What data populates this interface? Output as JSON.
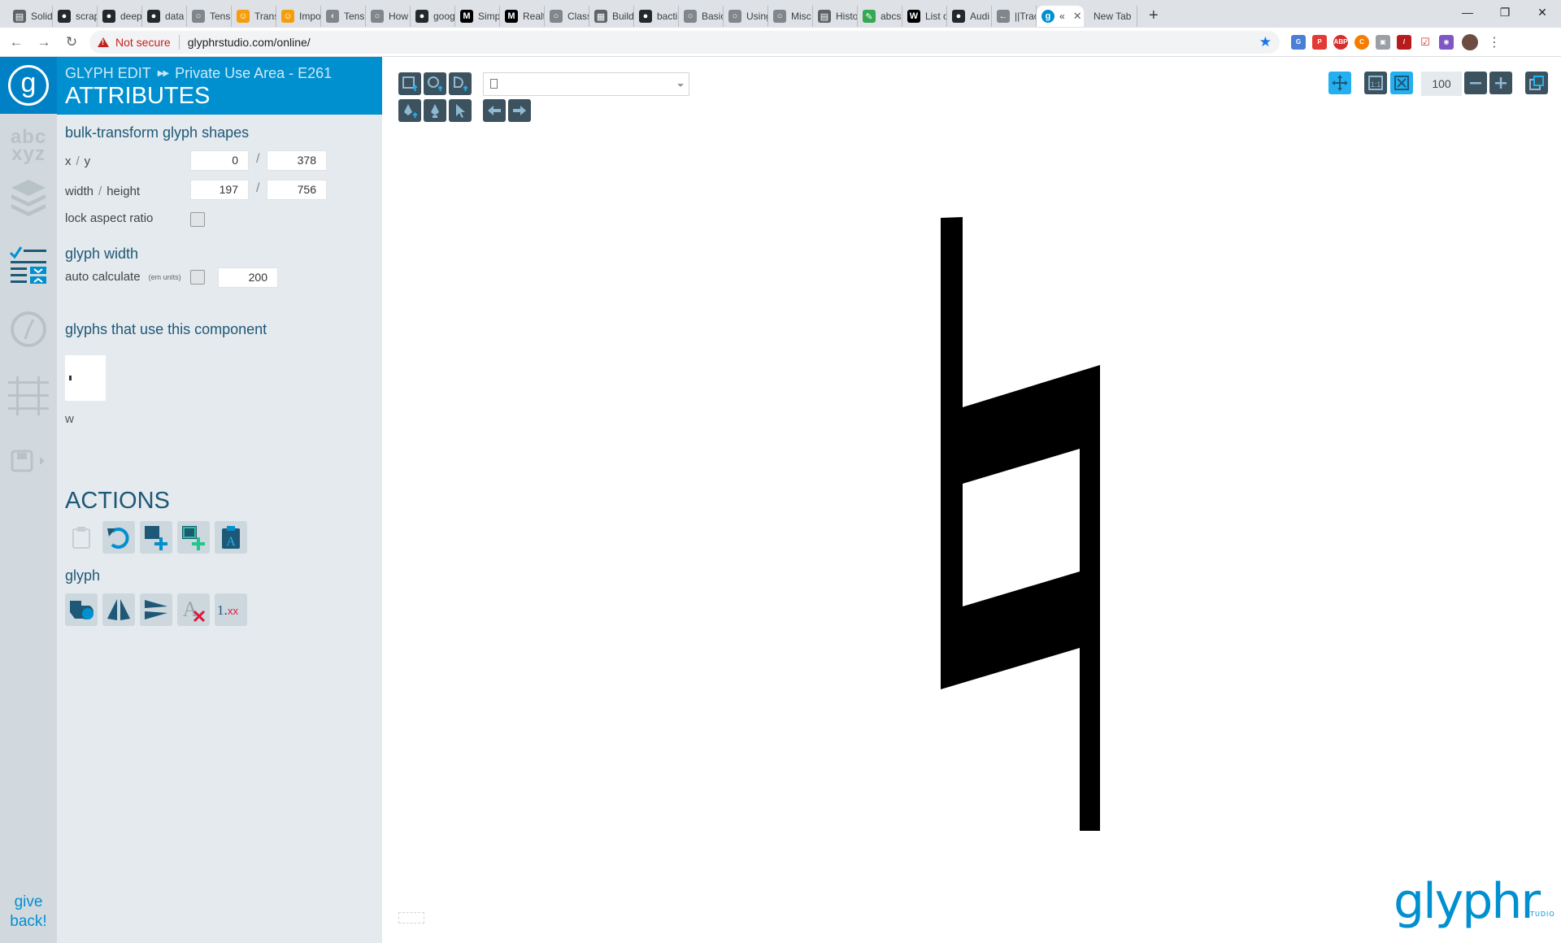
{
  "browser": {
    "tabs": [
      {
        "label": "Solid",
        "icon": "sheet-icon",
        "color": "#5f6368"
      },
      {
        "label": "scrap",
        "icon": "github-icon",
        "color": "#24292e"
      },
      {
        "label": "deep",
        "icon": "github-icon",
        "color": "#24292e"
      },
      {
        "label": "data",
        "icon": "github-icon",
        "color": "#24292e"
      },
      {
        "label": "Tens",
        "icon": "globe-icon",
        "color": "#80868b"
      },
      {
        "label": "Trans",
        "icon": "hugging-icon",
        "color": "#f59e0b"
      },
      {
        "label": "Impo",
        "icon": "hugging-icon",
        "color": "#f59e0b"
      },
      {
        "label": "Tens",
        "icon": "code-icon",
        "color": "#80868b"
      },
      {
        "label": "How",
        "icon": "globe-icon",
        "color": "#80868b"
      },
      {
        "label": "goog",
        "icon": "github-icon",
        "color": "#24292e"
      },
      {
        "label": "Simp",
        "icon": "medium-icon",
        "color": "#000000"
      },
      {
        "label": "Realt",
        "icon": "medium-icon",
        "color": "#000000"
      },
      {
        "label": "Class",
        "icon": "globe-icon",
        "color": "#80868b"
      },
      {
        "label": "Build",
        "icon": "grid-icon",
        "color": "#5f6368"
      },
      {
        "label": "bacti",
        "icon": "github-icon",
        "color": "#24292e"
      },
      {
        "label": "Basic",
        "icon": "globe-icon",
        "color": "#80868b"
      },
      {
        "label": "Using",
        "icon": "globe-icon",
        "color": "#80868b"
      },
      {
        "label": "Misc",
        "icon": "globe-icon",
        "color": "#80868b"
      },
      {
        "label": "Histo",
        "icon": "sheet-icon",
        "color": "#5f6368"
      },
      {
        "label": "abcs",
        "icon": "pencil-icon",
        "color": "#34a853"
      },
      {
        "label": "List o",
        "icon": "wikipedia-icon",
        "color": "#000000"
      },
      {
        "label": "Audi",
        "icon": "github-icon",
        "color": "#24292e"
      },
      {
        "label": "||Trac",
        "icon": "arrow-icon",
        "color": "#80868b"
      }
    ],
    "active_tab": {
      "label": "«",
      "icon": "glyphr-icon",
      "color": "#0090d0"
    },
    "new_tab_label": "New Tab",
    "security_label": "Not secure",
    "url": "glyphrstudio.com/online/"
  },
  "panel": {
    "breadcrumb_mode": "GLYPH EDIT",
    "breadcrumb_glyph": "Private Use Area - E261",
    "title": "ATTRIBUTES",
    "bulk_heading": "bulk-transform glyph shapes",
    "xy_label_x": "x",
    "xy_label_y": "y",
    "x_value": "0",
    "y_value": "378",
    "wh_label_w": "width",
    "wh_label_h": "height",
    "width_value": "197",
    "height_value": "756",
    "lock_aspect_label": "lock aspect ratio",
    "lock_aspect_checked": false,
    "glyph_width_heading": "glyph width",
    "auto_calc_label": "auto calculate",
    "em_units_note": "(em units)",
    "auto_calc_checked": false,
    "glyph_width_value": "200",
    "uses_heading": "glyphs that use this component",
    "used_by_glyph": "w",
    "actions_heading": "ACTIONS",
    "glyph_subheading": "glyph",
    "give_back": "give back!"
  },
  "canvas": {
    "zoom_value": "100",
    "brand": "glyphr",
    "brand_sub": "STUDIO"
  },
  "colors": {
    "brand_blue": "#0090d0",
    "tool_dark": "#3d525f",
    "panel_bg": "#e5eaee",
    "rail_bg": "#d2d9de",
    "active_tool": "#22b0f0"
  }
}
